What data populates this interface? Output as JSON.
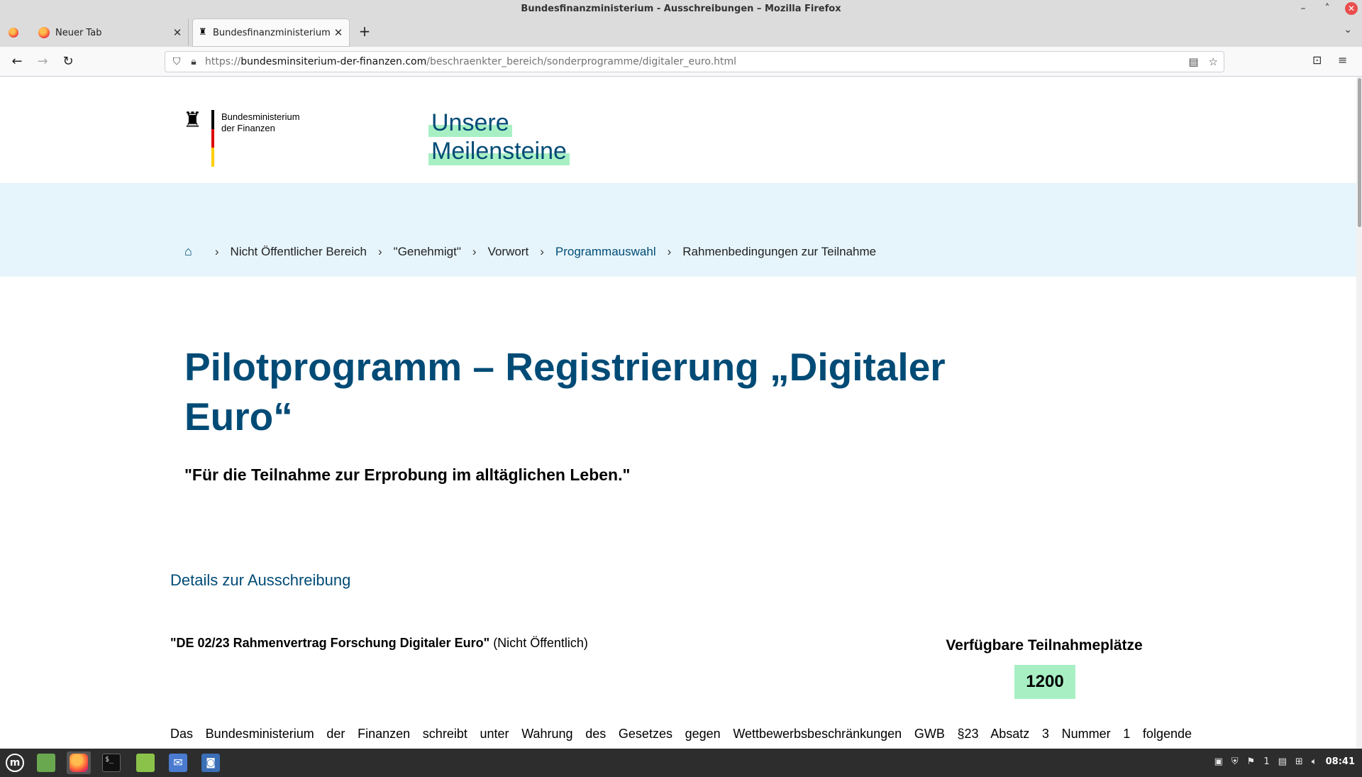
{
  "window": {
    "title": "Bundesfinanzministerium - Ausschreibungen – Mozilla Firefox",
    "minimize": "–",
    "maximize": "˄",
    "close": "✕"
  },
  "tabs": [
    {
      "label": "Neuer Tab",
      "active": false
    },
    {
      "label": "Bundesfinanzministerium - Aus",
      "active": true
    }
  ],
  "tab_controls": {
    "close": "✕",
    "new_tab": "+",
    "list_all": "⌄"
  },
  "navbar": {
    "back": "←",
    "forward": "→",
    "reload": "↻",
    "url_scheme": "https://",
    "url_host": "bundesminsiterium-der-finanzen.com",
    "url_path": "/beschraenkter_bereich/sonderprogramme/digitaler_euro.html",
    "reader_icon": "▤",
    "bookmark_icon": "☆",
    "pocket_icon": "⊡",
    "menu_icon": "≡"
  },
  "site": {
    "logo_eagle": "🦅",
    "logo_line1": "Bundesministerium",
    "logo_line2": "der Finanzen",
    "flag_colors": [
      "#000000",
      "#dd0000",
      "#ffce00"
    ],
    "milestones_line1": "Unsere",
    "milestones_line2": "Meilensteine"
  },
  "breadcrumb": {
    "home_icon": "⌂",
    "separator": "›",
    "items": [
      {
        "label": "Nicht Öffentlicher Bereich",
        "link": false
      },
      {
        "label": "\"Genehmigt\"",
        "link": false
      },
      {
        "label": "Vorwort",
        "link": false
      },
      {
        "label": "Programmauswahl",
        "link": true
      },
      {
        "label": "Rahmenbedingungen zur Teilnahme",
        "link": false
      }
    ]
  },
  "main": {
    "headline": "Pilotprogramm – Registrierung „Digitaler Euro“",
    "subtitle": "\"Für die Teilnahme zur Erprobung im alltäglichen Leben.\"",
    "details_link": "Details zur Ausschreibung",
    "contract_title": "\"DE 02/23 Rahmenvertrag Forschung Digitaler Euro\"",
    "contract_note": " (Nicht Öffentlich)",
    "seats_label": "Verfügbare Teilnahmeplätze",
    "seats_value": "1200",
    "body_text": "Das Bundesministerium der Finanzen schreibt unter Wahrung des Gesetzes gegen Wettbewerbsbeschränkungen GWB §23 Absatz 3 Nummer 1 folgende"
  },
  "colors": {
    "brand_blue": "#004b76",
    "highlight_green": "#a8f0c4",
    "breadcrumb_band": "#e6f5fb"
  },
  "taskbar": {
    "apps": [
      "mint-menu",
      "show-desktop",
      "firefox",
      "terminal",
      "files",
      "mail",
      "screenshot"
    ],
    "tray_workspace": "1",
    "clock": "08:41"
  }
}
